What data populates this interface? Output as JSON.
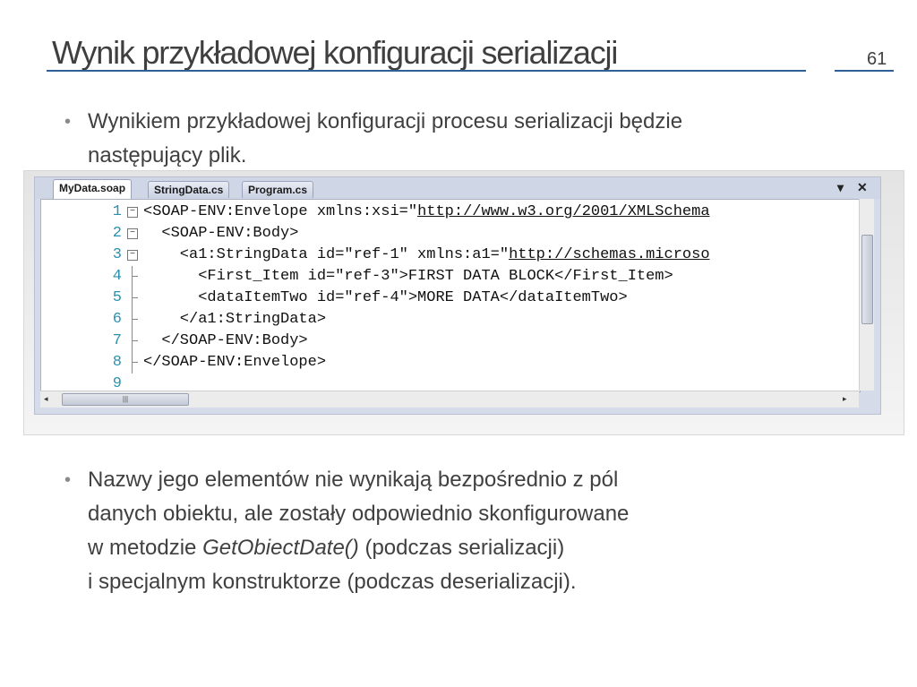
{
  "slide": {
    "title": "Wynik przykładowej konfiguracji serializacji",
    "number": "61"
  },
  "bullet1": {
    "line1": "Wynikiem przykładowej konfiguracji procesu serializacji będzie",
    "line2": "następujący plik."
  },
  "editor": {
    "tabs": [
      "MyData.soap",
      "StringData.cs",
      "Program.cs"
    ],
    "dropdown_icon": "▾",
    "close_icon": "✕",
    "lines": [
      {
        "n": "1",
        "pre": "<SOAP-ENV:Envelope xmlns:xsi=\"",
        "link": "http://www.w3.org/2001/XMLSchema",
        "post": ""
      },
      {
        "n": "2",
        "pre": "  <SOAP-ENV:Body>",
        "link": "",
        "post": ""
      },
      {
        "n": "3",
        "pre": "    <a1:StringData id=\"ref-1\" xmlns:a1=\"",
        "link": "http://schemas.microso",
        "post": ""
      },
      {
        "n": "4",
        "pre": "      <First_Item id=\"ref-3\">FIRST DATA BLOCK</First_Item>",
        "link": "",
        "post": ""
      },
      {
        "n": "5",
        "pre": "      <dataItemTwo id=\"ref-4\">MORE DATA</dataItemTwo>",
        "link": "",
        "post": ""
      },
      {
        "n": "6",
        "pre": "    </a1:StringData>",
        "link": "",
        "post": ""
      },
      {
        "n": "7",
        "pre": "  </SOAP-ENV:Body>",
        "link": "",
        "post": ""
      },
      {
        "n": "8",
        "pre": "</SOAP-ENV:Envelope>",
        "link": "",
        "post": ""
      },
      {
        "n": "9",
        "pre": "",
        "link": "",
        "post": ""
      }
    ]
  },
  "bullet2": {
    "line1": "Nazwy jego elementów nie wynikają bezpośrednio z pól",
    "line2": "danych obiektu, ale zostały odpowiednio skonfigurowane",
    "line3_pre": "w metodzie ",
    "line3_em": "GetObiectDate()",
    "line3_post": " (podczas serializacji)",
    "line4": "i specjalnym konstruktorze (podczas deserializacji)."
  }
}
